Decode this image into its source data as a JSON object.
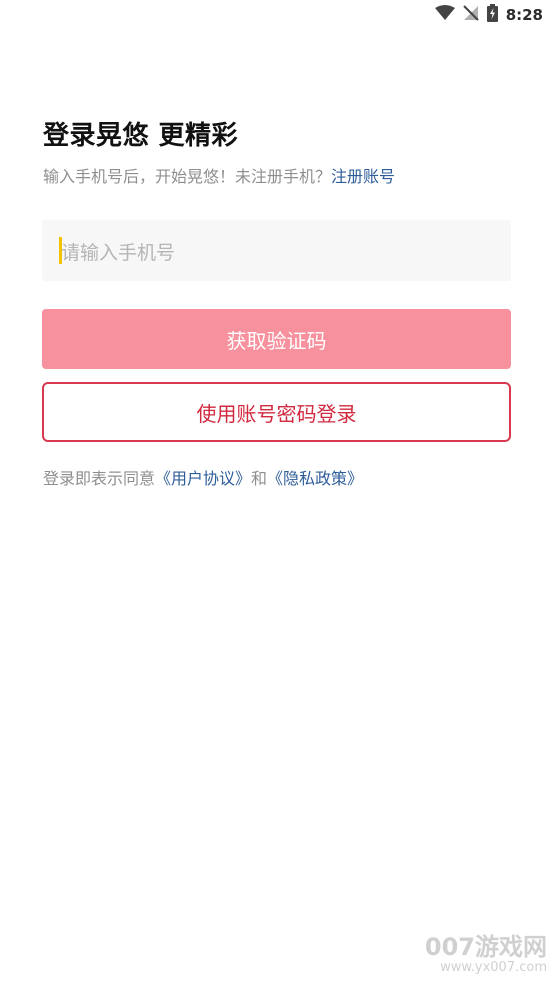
{
  "status_bar": {
    "time": "8:28"
  },
  "login": {
    "title": "登录晃悠 更精彩",
    "subtitle_prefix": "输入手机号后，开始晃悠！未注册手机？",
    "register_link": "注册账号",
    "phone_placeholder": "请输入手机号",
    "get_code_button": "获取验证码",
    "account_login_button": "使用账号密码登录",
    "agreement_prefix": "登录即表示同意",
    "user_agreement_link": "《用户协议》",
    "agreement_and": "和",
    "privacy_policy_link": "《隐私政策》"
  },
  "watermark": {
    "main": "007游戏网",
    "sub": "www.yx007.com"
  },
  "colors": {
    "primary_disabled": "#f6919d",
    "primary": "#d9384f",
    "link": "#2f5d9a",
    "caret": "#f3c200"
  }
}
